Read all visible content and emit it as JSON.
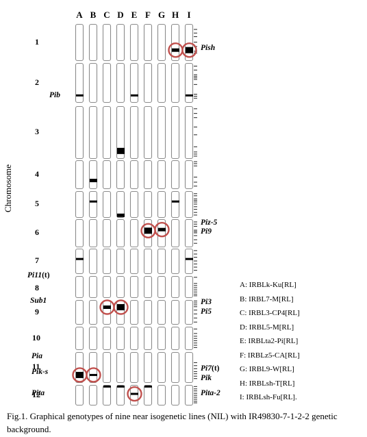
{
  "figure": {
    "axis_title": "Chromosome",
    "lines": [
      "A",
      "B",
      "C",
      "D",
      "E",
      "F",
      "G",
      "H",
      "I"
    ],
    "chromosomes": [
      "1",
      "2",
      "3",
      "4",
      "5",
      "6",
      "7",
      "8",
      "9",
      "10",
      "11",
      "12"
    ],
    "genes_left": [
      {
        "chromosome": "2",
        "label": "Pib"
      },
      {
        "chromosome": "8",
        "label": "Pi11",
        "suffix": "(t)"
      },
      {
        "chromosome": "9",
        "label": "Sub1"
      },
      {
        "chromosome": "11",
        "label": "Pia"
      },
      {
        "chromosome": "11",
        "label": "Pik-s"
      },
      {
        "chromosome": "12",
        "label": "Pita"
      }
    ],
    "genes_right": [
      {
        "chromosome": "1",
        "label": "Pish"
      },
      {
        "chromosome": "6",
        "label": "Piz-5"
      },
      {
        "chromosome": "6",
        "label": "Pi9"
      },
      {
        "chromosome": "9",
        "label": "Pi3"
      },
      {
        "chromosome": "9",
        "label": "Pi5"
      },
      {
        "chromosome": "11",
        "label": "Pi7",
        "suffix": "(t)"
      },
      {
        "chromosome": "11",
        "label": "Pik"
      },
      {
        "chromosome": "12",
        "label": "Pita-2"
      }
    ],
    "segments": [
      {
        "line": "H",
        "chromosome": "1",
        "position": 0.72,
        "size": "small",
        "circled": true
      },
      {
        "line": "I",
        "chromosome": "1",
        "position": 0.72,
        "size": "large",
        "circled": true
      },
      {
        "line": "A",
        "chromosome": "2",
        "position": 0.83,
        "size": "thin",
        "circled": false
      },
      {
        "line": "E",
        "chromosome": "2",
        "position": 0.83,
        "size": "thin",
        "circled": false
      },
      {
        "line": "I",
        "chromosome": "2",
        "position": 0.83,
        "size": "thin",
        "circled": false
      },
      {
        "line": "D",
        "chromosome": "3",
        "position": 0.86,
        "size": "large",
        "circled": false
      },
      {
        "line": "B",
        "chromosome": "4",
        "position": 0.72,
        "size": "small",
        "circled": false
      },
      {
        "line": "B",
        "chromosome": "5",
        "position": 0.4,
        "size": "thin",
        "circled": false
      },
      {
        "line": "H",
        "chromosome": "5",
        "position": 0.4,
        "size": "thin",
        "circled": false
      },
      {
        "line": "D",
        "chromosome": "5",
        "position": 0.93,
        "size": "small",
        "circled": false
      },
      {
        "line": "F",
        "chromosome": "6",
        "position": 0.42,
        "size": "large",
        "circled": true
      },
      {
        "line": "G",
        "chromosome": "6",
        "position": 0.38,
        "size": "small",
        "circled": true
      },
      {
        "line": "A",
        "chromosome": "7",
        "position": 0.42,
        "size": "thin",
        "circled": false
      },
      {
        "line": "I",
        "chromosome": "7",
        "position": 0.42,
        "size": "thin",
        "circled": false
      },
      {
        "line": "C",
        "chromosome": "9",
        "position": 0.3,
        "size": "small",
        "circled": true
      },
      {
        "line": "D",
        "chromosome": "9",
        "position": 0.3,
        "size": "large",
        "circled": true
      },
      {
        "line": "A",
        "chromosome": "11",
        "position": 0.76,
        "size": "large",
        "circled": true
      },
      {
        "line": "B",
        "chromosome": "11",
        "position": 0.76,
        "size": "thin",
        "circled": true
      },
      {
        "line": "C",
        "chromosome": "12",
        "position": 0.08,
        "size": "thin",
        "circled": false
      },
      {
        "line": "D",
        "chromosome": "12",
        "position": 0.08,
        "size": "thin",
        "circled": false
      },
      {
        "line": "E",
        "chromosome": "12",
        "position": 0.45,
        "size": "thin",
        "circled": true
      },
      {
        "line": "F",
        "chromosome": "12",
        "position": 0.08,
        "size": "thin",
        "circled": false
      }
    ],
    "legend": [
      "A: IRBLk-Ku[RL]",
      "B: IRBL7-M[RL]",
      "C: IRBL3-CP4[RL]",
      "D: IRBL5-M[RL]",
      "E: IRBLta2-Pi[RL]",
      "F: IRBLz5-CA[RL]",
      "G: IRBL9-W[RL]",
      "H: IRBLsh-T[RL]",
      "I: IRBLsh-Fu[RL]."
    ],
    "colors": {
      "box_stroke": "#8a8a8a",
      "segment": "#000000",
      "circle": "#c0504d"
    }
  },
  "caption": "Fig.1. Graphical genotypes of nine near isogenetic lines (NIL) with IR49830-7-1-2-2 genetic background."
}
